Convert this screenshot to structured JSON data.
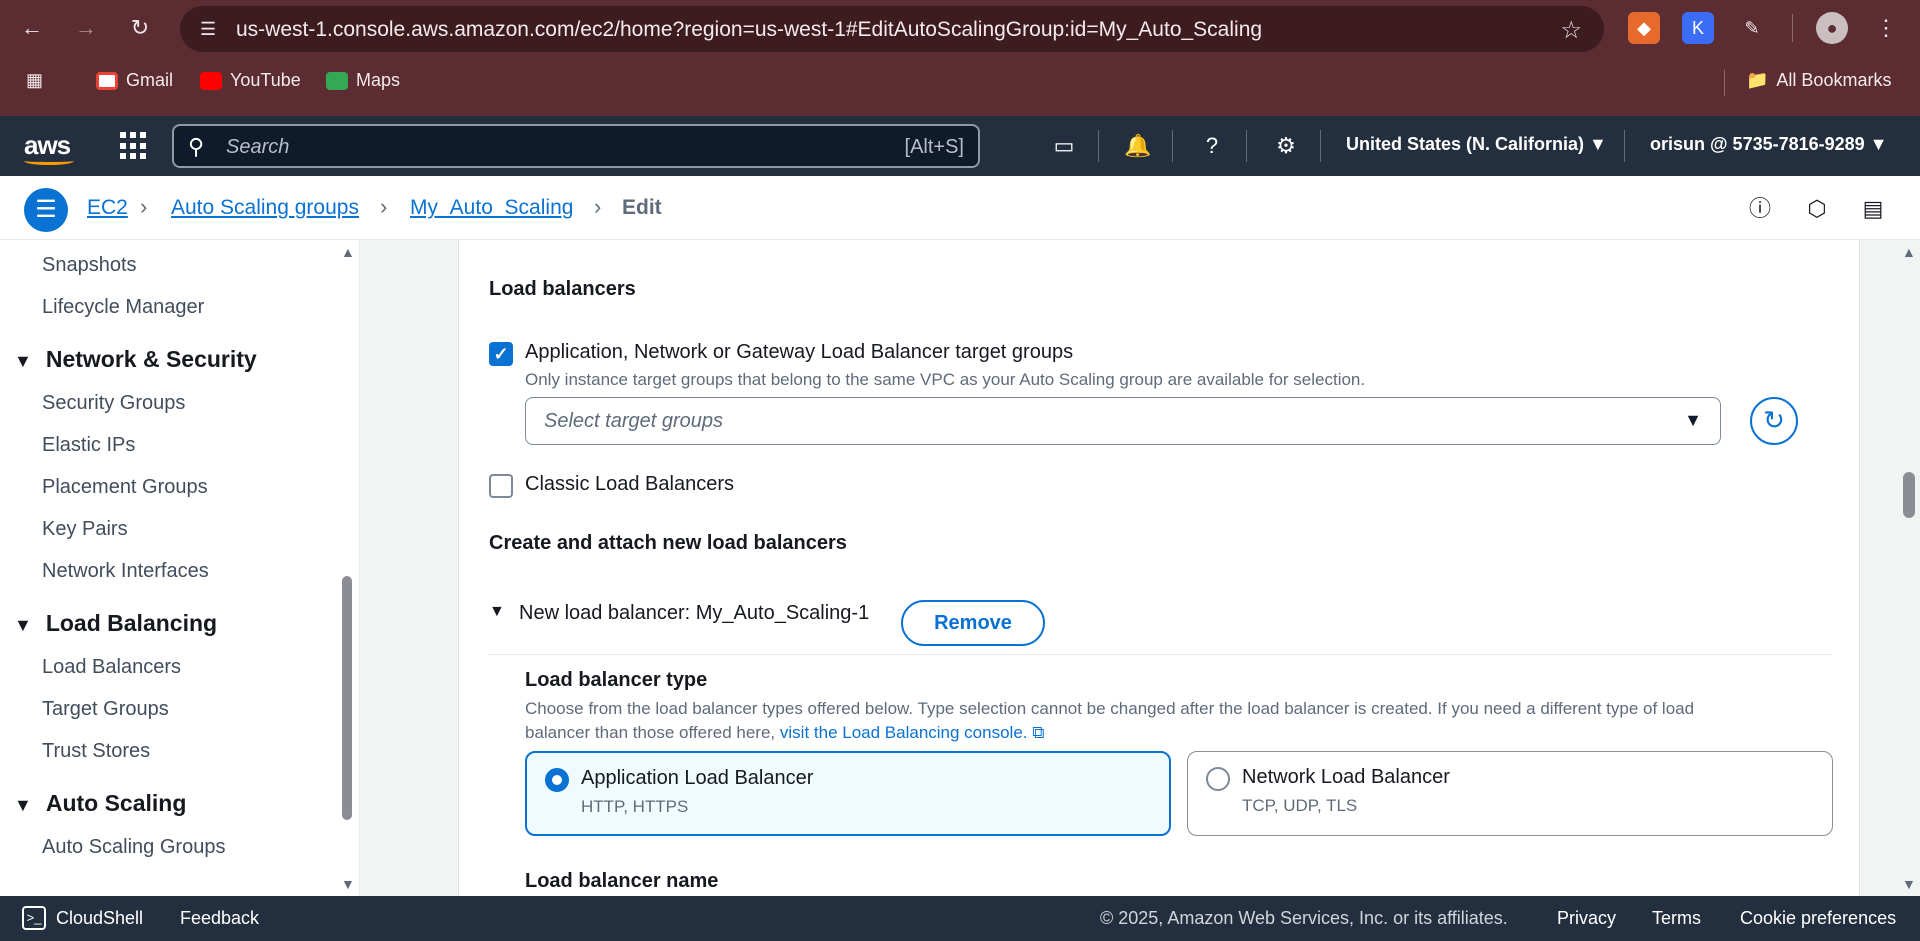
{
  "browser": {
    "url": "us-west-1.console.aws.amazon.com/ec2/home?region=us-west-1#EditAutoScalingGroup:id=My_Auto_Scaling",
    "bookmarks": [
      "Gmail",
      "YouTube",
      "Maps"
    ],
    "all_bookmarks": "All Bookmarks"
  },
  "aws_header": {
    "logo": "aws",
    "search_placeholder": "Search",
    "search_shortcut": "[Alt+S]",
    "region": "United States (N. California) ▼",
    "account": "orisun @ 5735-7816-9289 ▼"
  },
  "breadcrumb": {
    "items": [
      "EC2",
      "Auto Scaling groups",
      "My_Auto_Scaling"
    ],
    "current": "Edit"
  },
  "sidebar": {
    "top_items": [
      "Snapshots",
      "Lifecycle Manager"
    ],
    "sections": [
      {
        "title": "Network & Security",
        "items": [
          "Security Groups",
          "Elastic IPs",
          "Placement Groups",
          "Key Pairs",
          "Network Interfaces"
        ]
      },
      {
        "title": "Load Balancing",
        "items": [
          "Load Balancers",
          "Target Groups",
          "Trust Stores"
        ]
      },
      {
        "title": "Auto Scaling",
        "items": [
          "Auto Scaling Groups"
        ]
      }
    ]
  },
  "main": {
    "load_balancers_heading": "Load balancers",
    "target_groups_checkbox": "Application, Network or Gateway Load Balancer target groups",
    "target_groups_desc": "Only instance target groups that belong to the same VPC as your Auto Scaling group are available for selection.",
    "target_groups_placeholder": "Select target groups",
    "classic_checkbox": "Classic Load Balancers",
    "create_heading": "Create and attach new load balancers",
    "new_lb_label": "New load balancer: My_Auto_Scaling-1",
    "remove_button": "Remove",
    "lb_type_heading": "Load balancer type",
    "lb_type_desc_1": "Choose from the load balancer types offered below. Type selection cannot be changed after the load balancer is created. If you need a different type of load",
    "lb_type_desc_2": "balancer than those offered here,",
    "lb_console_link": "visit the Load Balancing console.",
    "options": [
      {
        "title": "Application Load Balancer",
        "sub": "HTTP, HTTPS",
        "selected": true
      },
      {
        "title": "Network Load Balancer",
        "sub": "TCP, UDP, TLS",
        "selected": false
      }
    ],
    "lb_name_heading": "Load balancer name"
  },
  "footer": {
    "cloudshell": "CloudShell",
    "feedback": "Feedback",
    "copyright": "© 2025, Amazon Web Services, Inc. or its affiliates.",
    "privacy": "Privacy",
    "terms": "Terms",
    "cookies": "Cookie preferences"
  },
  "colors": {
    "browser_chrome": "#5b2d33",
    "aws_nav": "#232f3e",
    "accent": "#0972d3",
    "aws_orange": "#ff9900"
  }
}
